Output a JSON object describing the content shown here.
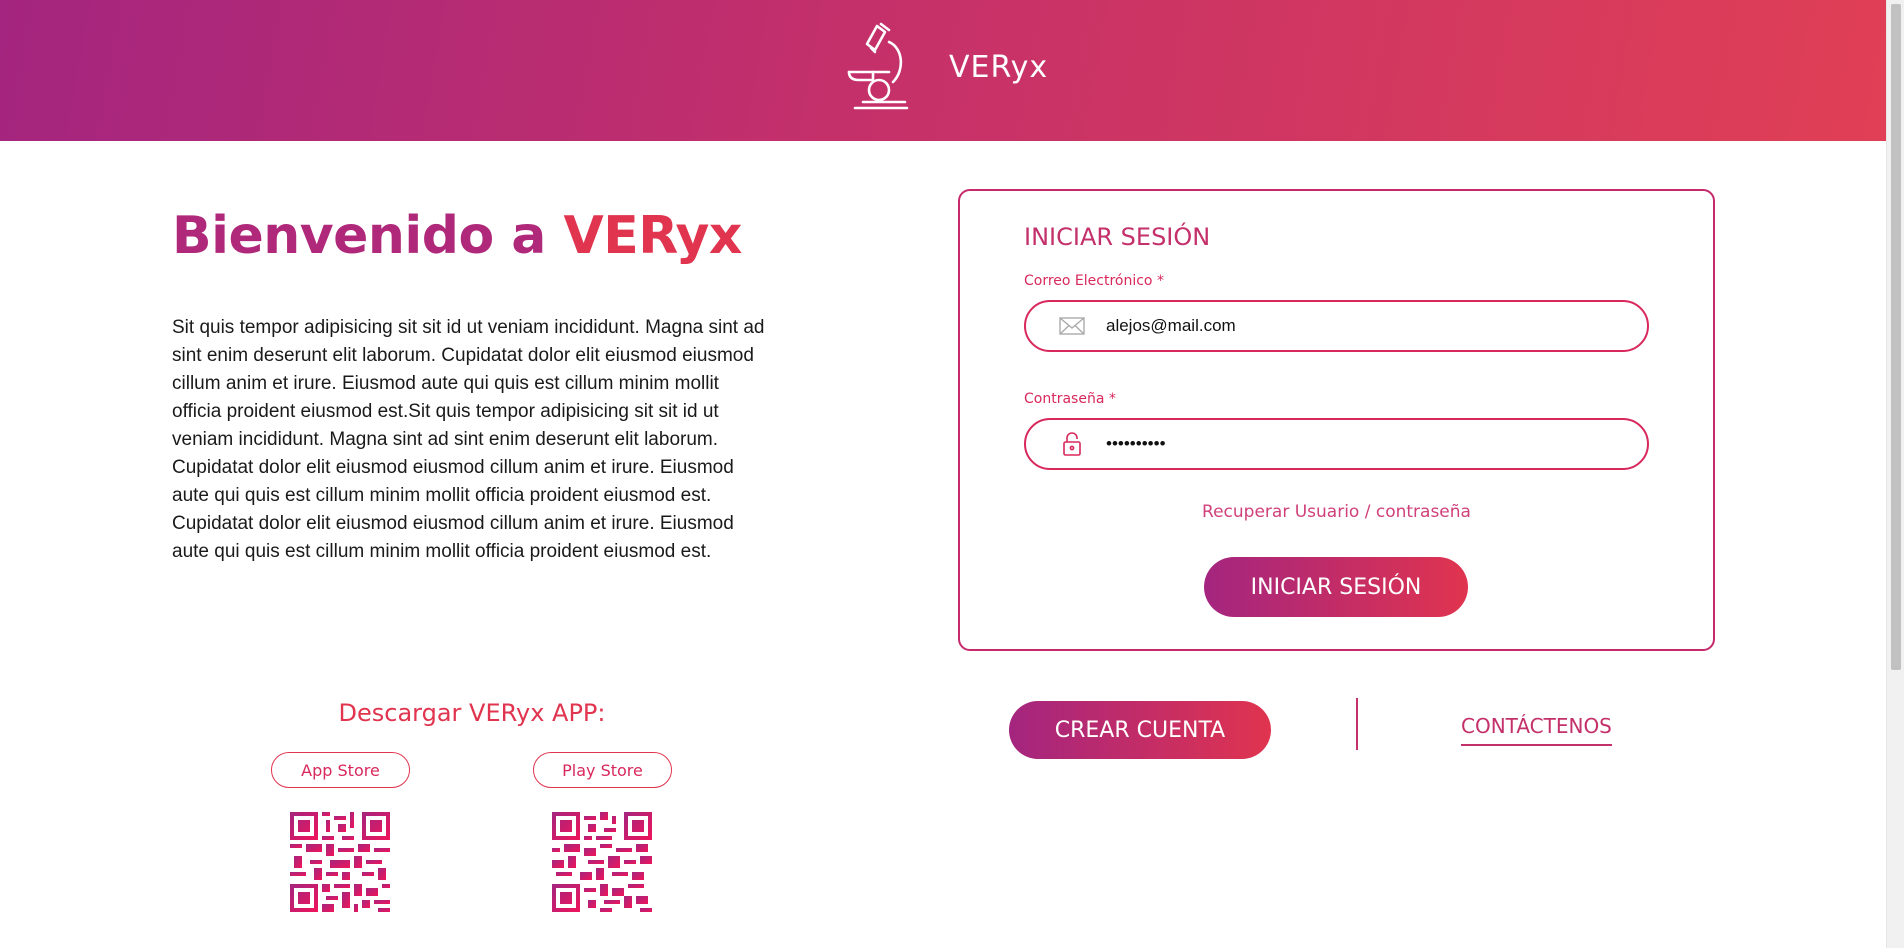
{
  "header": {
    "brand_name": "VERyx",
    "logo_icon": "microscope-icon"
  },
  "welcome": {
    "prefix": "Bienvenido a ",
    "brand": "VERyx"
  },
  "intro_text": "Sit quis tempor adipisicing sit sit id ut veniam incididunt. Magna sint ad sint enim deserunt elit laborum. Cupidatat dolor elit eiusmod eiusmod cillum anim et irure. Eiusmod aute qui quis est cillum minim mollit officia proident eiusmod est.Sit quis tempor adipisicing sit sit id ut veniam incididunt. Magna sint ad sint enim deserunt elit laborum. Cupidatat dolor elit eiusmod eiusmod cillum anim et irure. Eiusmod aute qui quis est cillum minim mollit officia proident eiusmod est. Cupidatat dolor elit eiusmod eiusmod cillum anim et irure. Eiusmod aute qui quis est cillum minim mollit officia proident eiusmod est.",
  "download": {
    "title": "Descargar VERyx APP:",
    "app_store_label": "App Store",
    "play_store_label": "Play Store"
  },
  "login": {
    "title": "INICIAR SESIÓN",
    "email_label": "Correo Electrónico *",
    "email_value": "alejos@mail.com",
    "password_label": "Contraseña *",
    "password_value": "••••••••••",
    "recover_link": "Recuperar Usuario / contraseña",
    "submit_label": "INICIAR SESIÓN"
  },
  "actions": {
    "create_account_label": "CREAR CUENTA",
    "contact_label": "CONTÁCTENOS"
  },
  "colors": {
    "gradient_start": "#a4257f",
    "gradient_end": "#e0344f",
    "accent": "#d8285c"
  }
}
